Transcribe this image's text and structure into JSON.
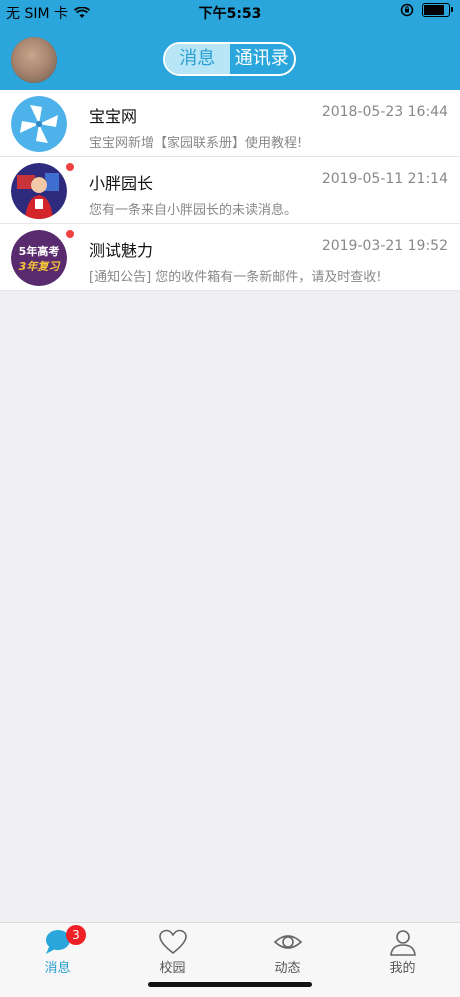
{
  "status_bar": {
    "carrier": "无 SIM 卡",
    "time": "下午5:53",
    "battery_level": 0.85
  },
  "header": {
    "segments": [
      {
        "label": "消息",
        "active": true
      },
      {
        "label": "通讯录",
        "active": false
      }
    ]
  },
  "conversations": [
    {
      "title": "宝宝网",
      "time": "2018-05-23 16:44",
      "preview": "宝宝网新增【家园联系册】使用教程!",
      "unread": false,
      "avatar": "pinwheel-logo"
    },
    {
      "title": "小胖园长",
      "time": "2019-05-11 21:14",
      "preview": "您有一条来自小胖园长的未读消息。",
      "unread": true,
      "avatar": "person-photo"
    },
    {
      "title": "测试魅力",
      "time": "2019-03-21 19:52",
      "preview": "[通知公告] 您的收件箱有一条新邮件，请及时查收!",
      "unread": true,
      "avatar": "book-cover",
      "avatar_text": [
        "5年高考",
        "3年复习"
      ]
    }
  ],
  "tabbar": {
    "items": [
      {
        "label": "消息",
        "icon": "chat-bubble-icon",
        "active": true,
        "badge": "3"
      },
      {
        "label": "校园",
        "icon": "heart-icon",
        "active": false
      },
      {
        "label": "动态",
        "icon": "eye-icon",
        "active": false
      },
      {
        "label": "我的",
        "icon": "user-icon",
        "active": false
      }
    ]
  },
  "colors": {
    "primary": "#2aa6dc",
    "badge": "#ee1f25",
    "unread_dot": "#f04141"
  }
}
